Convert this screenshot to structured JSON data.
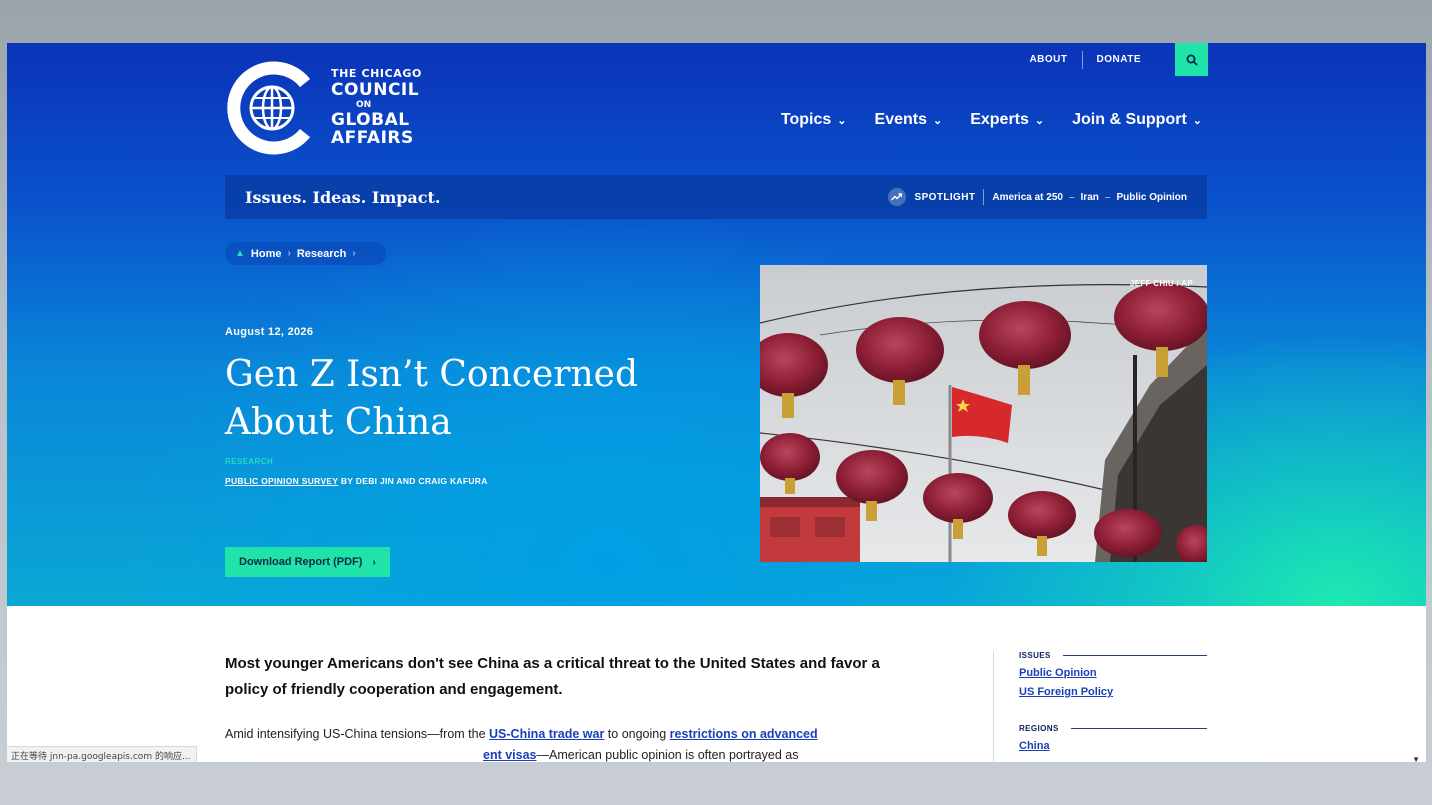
{
  "header": {
    "logo": {
      "line1": "THE CHICAGO",
      "line2": "COUNCIL",
      "line3": "ON",
      "line4": "GLOBAL",
      "line5": "AFFAIRS"
    },
    "util_nav": {
      "about": "ABOUT",
      "donate": "DONATE"
    },
    "main_nav": [
      {
        "label": "Topics"
      },
      {
        "label": "Events"
      },
      {
        "label": "Experts"
      },
      {
        "label": "Join & Support"
      }
    ]
  },
  "bar": {
    "tagline": "Issues. Ideas. Impact.",
    "spotlight_label": "SPOTLIGHT",
    "links": [
      "America at 250",
      "Iran",
      "Public Opinion"
    ]
  },
  "breadcrumb": [
    "Home",
    "Research"
  ],
  "article": {
    "date": "August 12, 2026",
    "title": "Gen Z Isn’t Concerned About China",
    "kicker": "RESEARCH",
    "byline_link": "PUBLIC OPINION SURVEY",
    "byline_rest": " BY DEBI JIN AND CRAIG KAFURA",
    "download_label": "Download Report (PDF)",
    "photo_credit": "JEFF CHIU / AP",
    "lede": "Most younger Americans don't see China as a critical threat to the United States and favor a policy of friendly cooperation and engagement.",
    "para_start": "Amid intensifying US-China tensions—from the ",
    "link1": "US-China trade war",
    "para_mid": " to ongoing ",
    "link2": "restrictions on advanced",
    "link2b": "ent visas",
    "para_end": "—American public opinion is often portrayed as"
  },
  "sidebar": {
    "issues_heading": "ISSUES",
    "issues": [
      "Public Opinion",
      "US Foreign Policy"
    ],
    "regions_heading": "REGIONS",
    "regions": [
      "China"
    ]
  },
  "statusbar": "正在等待 jnn-pa.googleapis.com 的响应...",
  "colors": {
    "accent": "#1fe3a9",
    "link": "#1a3fb8",
    "hero_top": "#0b33b8"
  }
}
